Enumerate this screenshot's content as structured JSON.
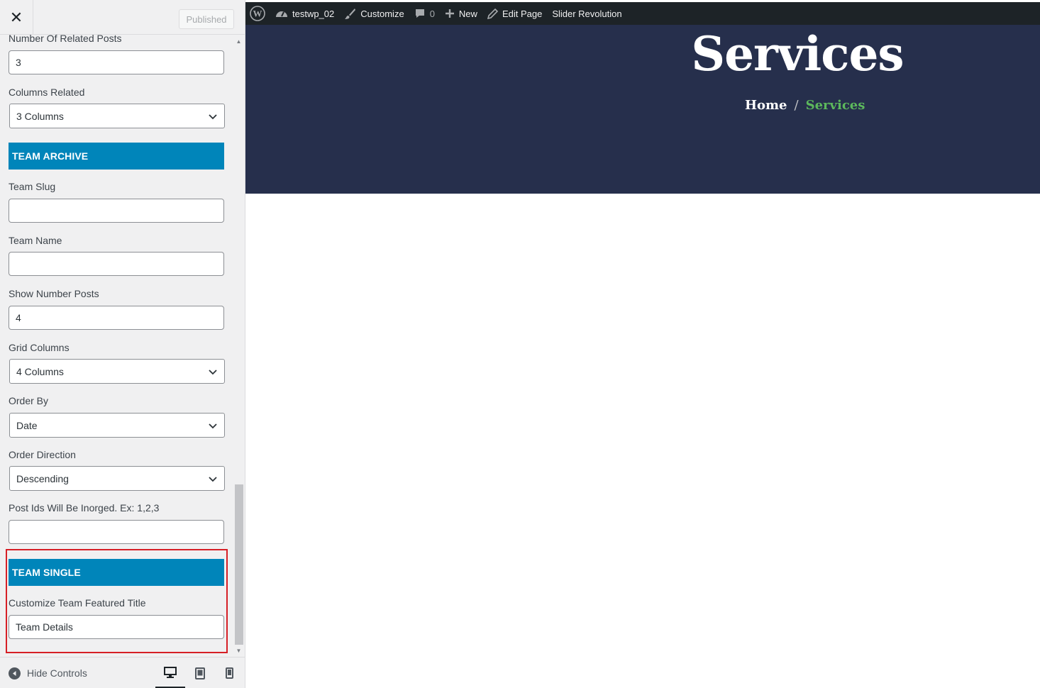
{
  "sidebar": {
    "close_glyph": "✕",
    "publish_label": "Published",
    "fields": {
      "related_posts": {
        "label": "Number Of Related Posts",
        "value": "3"
      },
      "columns_related": {
        "label": "Columns Related",
        "value": "3 Columns"
      },
      "team_archive_heading": "TEAM ARCHIVE",
      "team_slug": {
        "label": "Team Slug",
        "value": ""
      },
      "team_name": {
        "label": "Team Name",
        "value": ""
      },
      "show_number_posts": {
        "label": "Show Number Posts",
        "value": "4"
      },
      "grid_columns": {
        "label": "Grid Columns",
        "value": "4 Columns"
      },
      "order_by": {
        "label": "Order By",
        "value": "Date"
      },
      "order_direction": {
        "label": "Order Direction",
        "value": "Descending"
      },
      "post_ids": {
        "label": "Post Ids Will Be Inorged. Ex: 1,2,3",
        "value": ""
      },
      "team_single_heading": "TEAM SINGLE",
      "featured_title": {
        "label": "Customize Team Featured Title",
        "value": "Team Details"
      }
    },
    "footer": {
      "hide_controls_label": "Hide Controls",
      "devices": [
        "desktop-icon",
        "tablet-icon",
        "mobile-icon"
      ],
      "active_device": "desktop"
    }
  },
  "adminbar": {
    "site_name": "testwp_02",
    "customize": "Customize",
    "comments_count": "0",
    "new": "New",
    "edit_page": "Edit Page",
    "slider_revolution": "Slider Revolution"
  },
  "preview": {
    "hero_title": "Services",
    "breadcrumb": {
      "home": "Home",
      "separator": "/",
      "current": "Services"
    }
  },
  "colors": {
    "section_head": "#0085ba",
    "highlight": "#d61f26",
    "hero_bg": "#262f4c",
    "breadcrumb_current": "#5cb85c",
    "adminbar_bg": "#1d2327"
  }
}
